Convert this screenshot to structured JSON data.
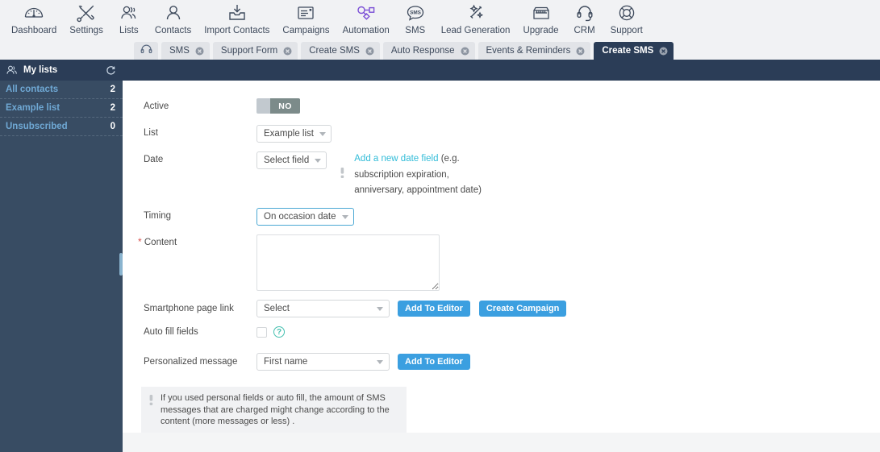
{
  "topnav": {
    "items": [
      {
        "label": "Dashboard",
        "icon": "gauge-icon"
      },
      {
        "label": "Settings",
        "icon": "tools-icon"
      },
      {
        "label": "Lists",
        "icon": "people-group-icon"
      },
      {
        "label": "Contacts",
        "icon": "person-icon"
      },
      {
        "label": "Import Contacts",
        "icon": "import-inbox-icon"
      },
      {
        "label": "Campaigns",
        "icon": "envelope-card-icon"
      },
      {
        "label": "Automation",
        "icon": "workflow-nodes-icon"
      },
      {
        "label": "SMS",
        "icon": "sms-bubble-icon"
      },
      {
        "label": "Lead Generation",
        "icon": "magic-wand-icon"
      },
      {
        "label": "Upgrade",
        "icon": "storefront-icon"
      },
      {
        "label": "CRM",
        "icon": "headset-icon"
      },
      {
        "label": "Support",
        "icon": "lifebuoy-icon"
      }
    ]
  },
  "tabs": {
    "icon_tab": "headphones-icon",
    "close_icon": "close-circle-icon",
    "items": [
      {
        "label": "SMS",
        "active": false
      },
      {
        "label": "Support Form",
        "active": false
      },
      {
        "label": "Create SMS",
        "active": false
      },
      {
        "label": "Auto Response",
        "active": false
      },
      {
        "label": "Events & Reminders",
        "active": false
      },
      {
        "label": "Create SMS",
        "active": true
      }
    ]
  },
  "sidebar": {
    "title": "My lists",
    "title_icon": "people-group-icon",
    "refresh_icon": "refresh-icon",
    "items": [
      {
        "label": "All contacts",
        "count": "2"
      },
      {
        "label": "Example list",
        "count": "2"
      },
      {
        "label": "Unsubscribed",
        "count": "0"
      }
    ]
  },
  "form": {
    "active": {
      "label": "Active",
      "toggle_value": "NO"
    },
    "list": {
      "label": "List",
      "value": "Example list"
    },
    "date": {
      "label": "Date",
      "value": "Select field",
      "link": "Add a new date field",
      "hint_line1": "(e.g.",
      "hint_line2": "subscription expiration,",
      "hint_line3": "anniversary, appointment date)",
      "hint_icon": "info-exclamation-icon"
    },
    "timing": {
      "label": "Timing",
      "value": "On occasion date"
    },
    "content": {
      "label": "Content",
      "required_marker": "*",
      "value": "",
      "placeholder": ""
    },
    "smartphone_page_link": {
      "label": "Smartphone page link",
      "value": "Select",
      "add_button": "Add To Editor",
      "create_button": "Create Campaign"
    },
    "auto_fill_fields": {
      "label": "Auto fill fields",
      "checked": false,
      "help_icon": "question-circle-icon",
      "help_glyph": "?"
    },
    "personalized_message": {
      "label": "Personalized message",
      "value": "First name",
      "add_button": "Add To Editor"
    }
  },
  "notice": {
    "icon": "info-exclamation-icon",
    "text": "If you used personal fields or auto fill, the amount of SMS messages that are charged might change according to the content (more messages or less) ."
  },
  "colors": {
    "navy": "#2b3d57",
    "sidebar": "#384c63",
    "nav_bg": "#f1f2f4",
    "link_cyan": "#32bcd8",
    "button_blue": "#3b9fe0",
    "sidebar_link": "#6fa8d4",
    "teal": "#46c0b0",
    "required_red": "#d9534f",
    "toggle_off": "#7c8b8a"
  }
}
